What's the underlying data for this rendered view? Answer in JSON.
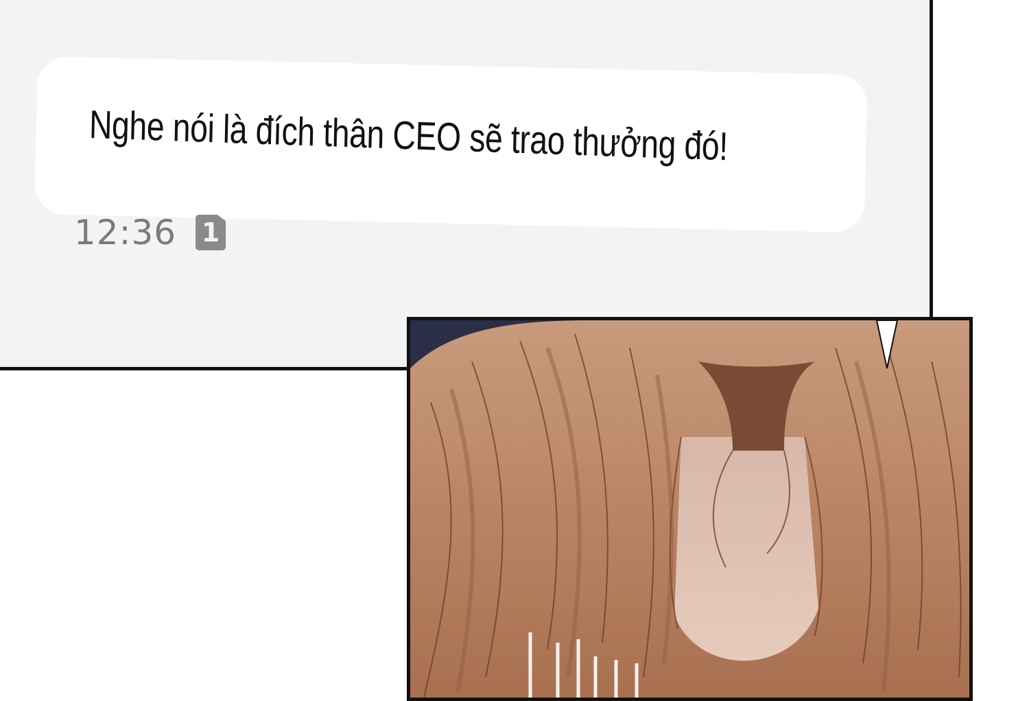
{
  "chat": {
    "message": "Nghe nói là đích thân CEO sẽ trao thưởng đó!",
    "time": "12:36",
    "unread_count": "1"
  },
  "colors": {
    "panel_bg": "#f2f3f5",
    "bubble_bg": "#ffffff",
    "border": "#111111",
    "hair": "#b98466"
  }
}
